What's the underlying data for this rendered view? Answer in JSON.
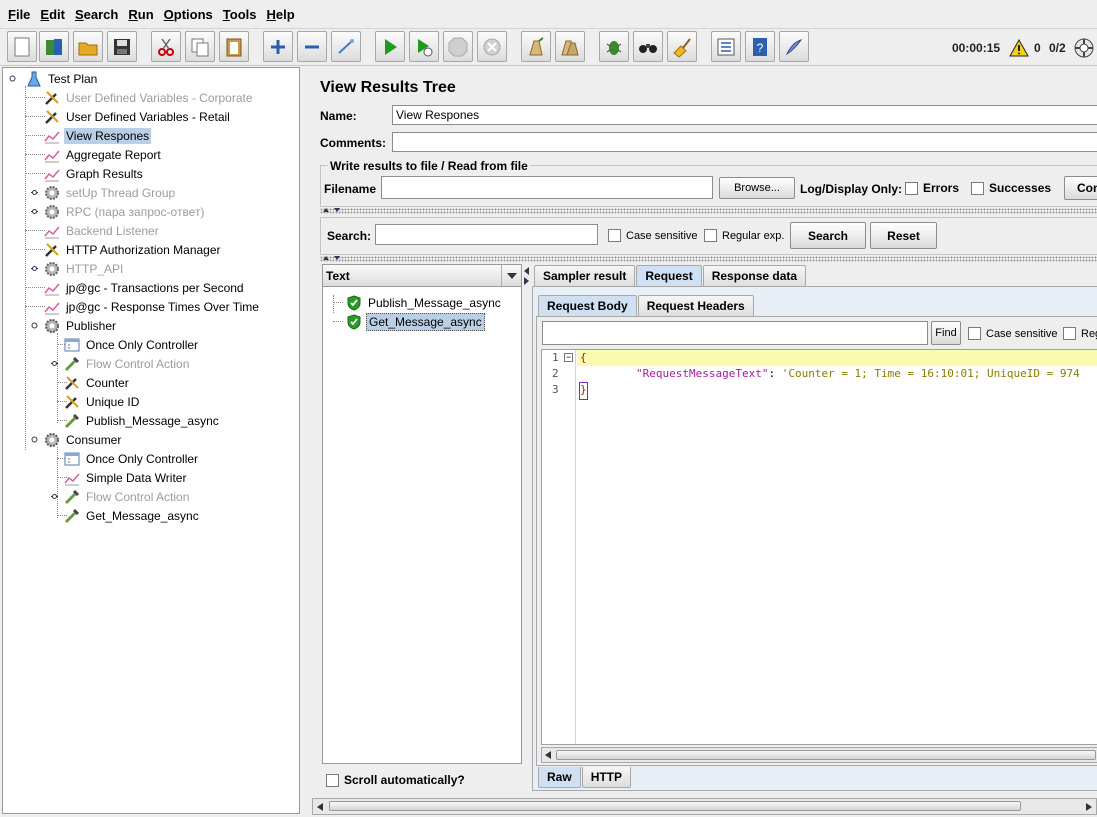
{
  "menu": [
    "File",
    "Edit",
    "Search",
    "Run",
    "Options",
    "Tools",
    "Help"
  ],
  "toolbar": {
    "timer": "00:00:15",
    "warning_count": "0",
    "threads": "0/2"
  },
  "tree": {
    "items": [
      {
        "label": "Test Plan",
        "icon": "test-plan-icon"
      },
      {
        "label": "User Defined Variables - Corporate",
        "icon": "wrench-icon"
      },
      {
        "label": "User Defined Variables - Retail",
        "icon": "wrench-icon"
      },
      {
        "label": "View Respones",
        "icon": "listener-graph-icon"
      },
      {
        "label": "Aggregate Report",
        "icon": "listener-graph-icon"
      },
      {
        "label": "Graph Results",
        "icon": "listener-graph-icon"
      },
      {
        "label": "setUp Thread Group",
        "icon": "gear-icon"
      },
      {
        "label": "RPC (пара запрос-ответ)",
        "icon": "gear-icon"
      },
      {
        "label": "Backend Listener",
        "icon": "listener-graph-icon"
      },
      {
        "label": "HTTP Authorization Manager",
        "icon": "wrench-icon"
      },
      {
        "label": "HTTP_API",
        "icon": "gear-icon"
      },
      {
        "label": "jp@gc - Transactions per Second",
        "icon": "listener-graph-icon"
      },
      {
        "label": "jp@gc - Response Times Over Time",
        "icon": "listener-graph-icon"
      },
      {
        "label": "Publisher",
        "icon": "gear-icon"
      },
      {
        "label": "Once Only Controller",
        "icon": "controller-icon"
      },
      {
        "label": "Flow Control Action",
        "icon": "pipette-icon"
      },
      {
        "label": "Counter",
        "icon": "wrench-icon"
      },
      {
        "label": "Unique ID",
        "icon": "wrench-icon"
      },
      {
        "label": "Publish_Message_async",
        "icon": "pipette-icon"
      },
      {
        "label": "Consumer",
        "icon": "gear-icon"
      },
      {
        "label": "Once Only Controller",
        "icon": "controller-icon"
      },
      {
        "label": "Simple Data Writer",
        "icon": "listener-graph-icon"
      },
      {
        "label": "Flow Control Action",
        "icon": "pipette-icon"
      },
      {
        "label": "Get_Message_async",
        "icon": "pipette-icon"
      }
    ]
  },
  "panel": {
    "title": "View Results Tree",
    "name_label": "Name:",
    "name_value": "View Respones",
    "comments_label": "Comments:",
    "comments_value": "",
    "file_group_title": "Write results to file / Read from file",
    "filename_label": "Filename",
    "filename_value": "",
    "browse_label": "Browse...",
    "log_display_label": "Log/Display Only:",
    "errors_label": "Errors",
    "successes_label": "Successes",
    "configure_label": "Con",
    "search_label": "Search:",
    "search_value": "",
    "case_sensitive_label": "Case sensitive",
    "regex_label": "Regular exp.",
    "search_button": "Search",
    "reset_button": "Reset"
  },
  "results": {
    "renderer": "Text",
    "samples": [
      "Publish_Message_async",
      "Get_Message_async"
    ],
    "scroll_label": "Scroll automatically?"
  },
  "detail": {
    "tabs": [
      "Sampler result",
      "Request",
      "Response data"
    ],
    "subtabs": [
      "Request Body",
      "Request Headers"
    ],
    "find_label": "Find",
    "find_case_label": "Case sensitive",
    "find_regex_label": "Reg",
    "code_lines": [
      {
        "num": "1",
        "text": "{"
      },
      {
        "num": "2",
        "key": "\"RequestMessageText\"",
        "sep": ": ",
        "value": "'Counter = 1; Time = 16:10:01; UniqueID = 974"
      },
      {
        "num": "3",
        "text": "}"
      }
    ],
    "bottom_tabs": [
      "Raw",
      "HTTP"
    ]
  },
  "colors": {
    "selection": "#b8cfe5",
    "tab_active": "#cfe0f2",
    "json_key": "#a31aa3",
    "json_value": "#8a7b00",
    "line_highlight": "#fbfbb0",
    "success_shield": "#2a9a2a"
  }
}
